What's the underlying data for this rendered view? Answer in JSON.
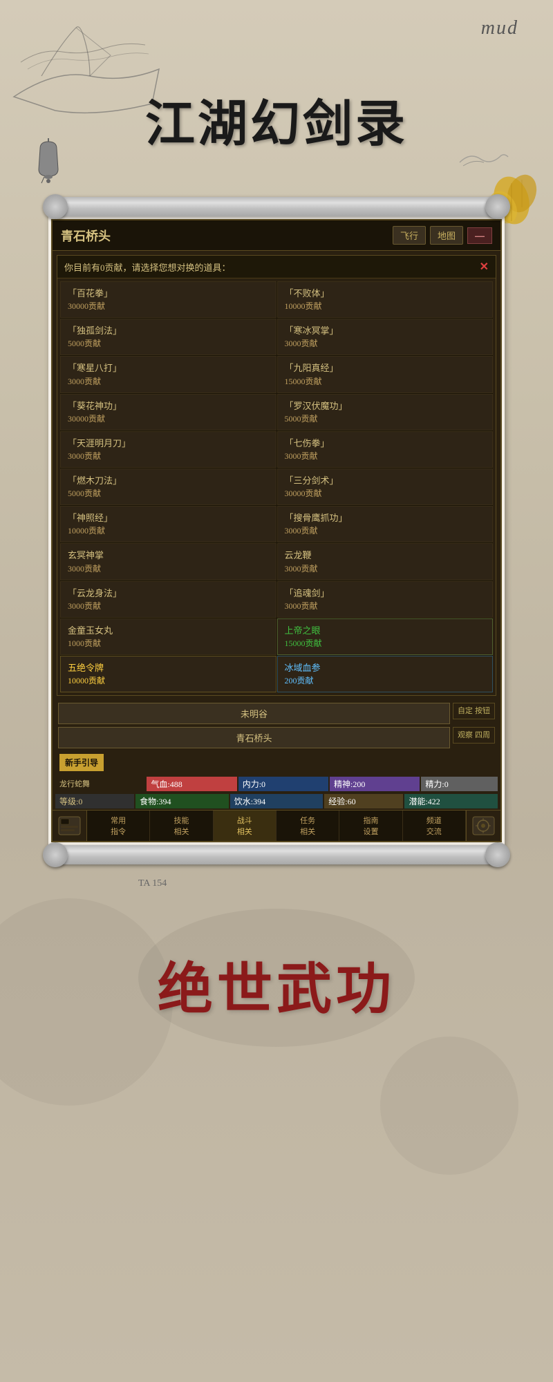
{
  "app": {
    "mud_label": "mud",
    "main_title": "江湖幻剑录",
    "bottom_title": "绝世武功"
  },
  "window": {
    "location": "青石桥头",
    "fly_btn": "飞行",
    "map_btn": "地图",
    "close_btn": "—"
  },
  "dialog": {
    "header_text": "你目前有0贡献，请选择您想对换的道具：",
    "close_x": "✕"
  },
  "items": [
    {
      "name": "「百花拳」",
      "cost": "30000贡献",
      "style": "normal"
    },
    {
      "name": "「不败体」",
      "cost": "10000贡献",
      "style": "normal"
    },
    {
      "name": "「独孤剑法」",
      "cost": "5000贡献",
      "style": "normal"
    },
    {
      "name": "「寒冰冥掌」",
      "cost": "3000贡献",
      "style": "normal"
    },
    {
      "name": "「寒星八打」",
      "cost": "3000贡献",
      "style": "normal"
    },
    {
      "name": "「九阳真经」",
      "cost": "15000贡献",
      "style": "normal"
    },
    {
      "name": "「葵花神功」",
      "cost": "30000贡献",
      "style": "normal"
    },
    {
      "name": "「罗汉伏魔功」",
      "cost": "5000贡献",
      "style": "normal"
    },
    {
      "name": "「天涯明月刀」",
      "cost": "3000贡献",
      "style": "normal"
    },
    {
      "name": "「七伤拳」",
      "cost": "3000贡献",
      "style": "normal"
    },
    {
      "name": "「燃木刀法」",
      "cost": "5000贡献",
      "style": "normal"
    },
    {
      "name": "「三分剑术」",
      "cost": "30000贡献",
      "style": "normal"
    },
    {
      "name": "「神照经」",
      "cost": "10000贡献",
      "style": "normal"
    },
    {
      "name": "「搜骨鹰抓功」",
      "cost": "3000贡献",
      "style": "normal"
    },
    {
      "name": "玄冥神掌",
      "cost": "3000贡献",
      "style": "normal"
    },
    {
      "name": "云龙鞭",
      "cost": "3000贡献",
      "style": "normal"
    },
    {
      "name": "「云龙身法」",
      "cost": "3000贡献",
      "style": "normal"
    },
    {
      "name": "「追魂剑」",
      "cost": "3000贡献",
      "style": "normal"
    },
    {
      "name": "金童玉女丸",
      "cost": "1000贡献",
      "style": "normal"
    },
    {
      "name": "上帝之眼",
      "cost": "15000贡献",
      "style": "green"
    },
    {
      "name": "五绝令牌",
      "cost": "10000贡献",
      "style": "gold"
    },
    {
      "name": "冰域血参",
      "cost": "200贡献",
      "style": "blue"
    }
  ],
  "action_buttons": {
    "location1": "未明谷",
    "location2": "青石桥头",
    "side1_line1": "自定",
    "side1_line2": "按钮",
    "side2_line1": "观察",
    "side2_line2": "四周"
  },
  "guide_btn": "新手引导",
  "stats": {
    "char_name": "龙行蛇舞",
    "hp_label": "气血:",
    "hp_val": "488",
    "mp_label": "内力:",
    "mp_val": "0",
    "sp_label": "精神:",
    "sp_val": "200",
    "pow_label": "精力:",
    "pow_val": "0",
    "level_label": "等级:",
    "level_val": "0",
    "food_label": "食物:",
    "food_val": "394",
    "water_label": "饮水:",
    "water_val": "394",
    "exp_label": "经验:",
    "exp_val": "60",
    "potential_label": "潜能:",
    "potential_val": "422"
  },
  "nav": {
    "common": "常用\n指令",
    "skills": "技能\n相关",
    "battle": "战斗\n相关",
    "tasks": "任务\n相关",
    "guide_settings": "指南\n设置",
    "channel": "频道\n交流"
  },
  "ta_text": "TA 154"
}
